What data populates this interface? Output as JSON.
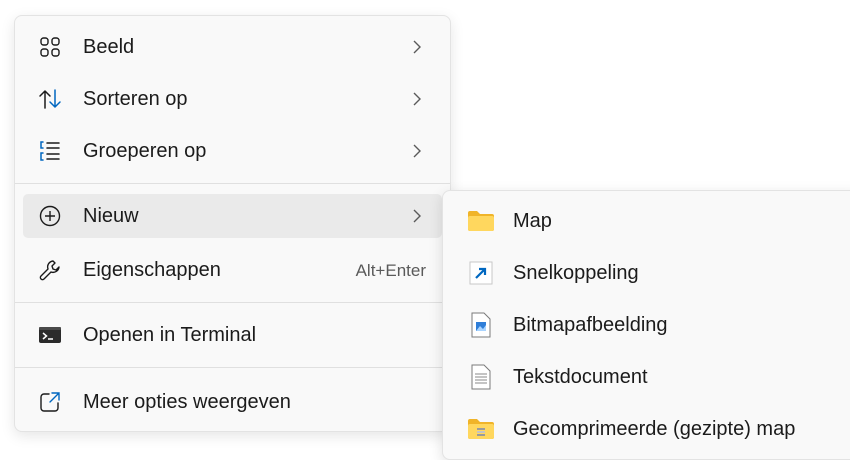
{
  "context_menu": {
    "items": [
      {
        "label": "Beeld",
        "icon": "grid-icon",
        "has_submenu": true
      },
      {
        "label": "Sorteren op",
        "icon": "sort-arrows-icon",
        "has_submenu": true
      },
      {
        "label": "Groeperen op",
        "icon": "group-list-icon",
        "has_submenu": true
      },
      {
        "label": "Nieuw",
        "icon": "plus-circle-icon",
        "has_submenu": true,
        "highlighted": true
      },
      {
        "label": "Eigenschappen",
        "icon": "wrench-icon",
        "shortcut": "Alt+Enter"
      },
      {
        "label": "Openen in Terminal",
        "icon": "terminal-icon"
      },
      {
        "label": "Meer opties weergeven",
        "icon": "external-window-icon"
      }
    ]
  },
  "new_submenu": {
    "items": [
      {
        "label": "Map",
        "icon": "folder-icon"
      },
      {
        "label": "Snelkoppeling",
        "icon": "shortcut-arrow-icon"
      },
      {
        "label": "Bitmapafbeelding",
        "icon": "bitmap-file-icon"
      },
      {
        "label": "Tekstdocument",
        "icon": "text-document-icon"
      },
      {
        "label": "Gecomprimeerde (gezipte) map",
        "icon": "zip-folder-icon"
      }
    ]
  },
  "colors": {
    "menu_bg": "#f9f9f9",
    "hover_bg": "#eaeaea",
    "accent": "#0067c0",
    "folder": "#f8c542"
  }
}
